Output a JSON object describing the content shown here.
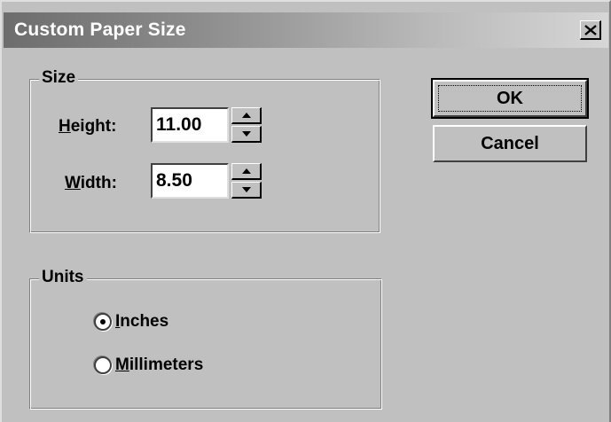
{
  "dialog": {
    "title": "Custom Paper Size",
    "close_icon": "close-icon"
  },
  "size_group": {
    "legend": "Size",
    "height": {
      "label_accel": "H",
      "label_rest": "eight:",
      "value": "11.00"
    },
    "width": {
      "label_accel": "W",
      "label_rest": "idth:",
      "value": "8.50"
    }
  },
  "units_group": {
    "legend": "Units",
    "options": [
      {
        "label_accel": "I",
        "label_rest": "nches",
        "selected": true
      },
      {
        "label_accel": "M",
        "label_rest": "illimeters",
        "selected": false
      }
    ]
  },
  "buttons": {
    "ok_label": "OK",
    "cancel_label": "Cancel"
  },
  "colors": {
    "face": "#c0c0c0",
    "title_gradient_start": "#6d6d6d",
    "title_gradient_end": "#d6d6d6"
  }
}
